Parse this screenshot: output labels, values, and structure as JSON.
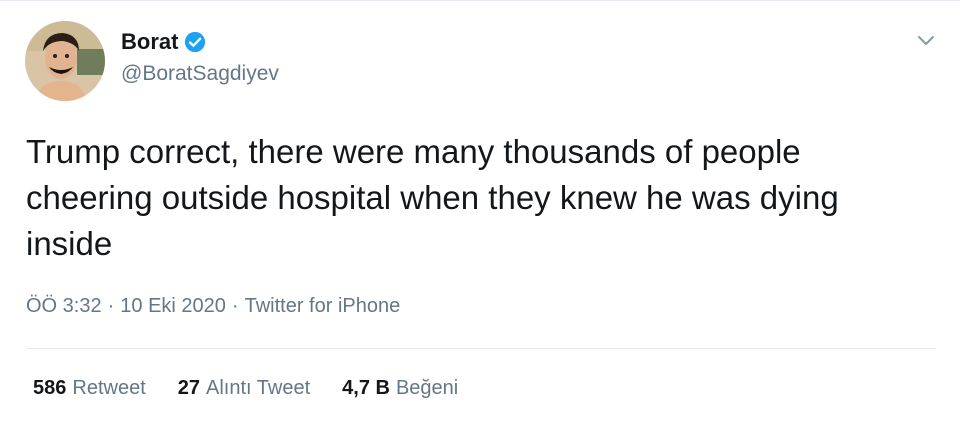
{
  "author": {
    "display_name": "Borat",
    "handle": "@BoratSagdiyev",
    "verified": true,
    "avatar_icon": "profile-photo-icon"
  },
  "tweet": {
    "text": "Trump correct, there were many thousands of people\ncheering outside hospital when they knew he was dying\ninside",
    "time": "ÖÖ 3:32",
    "separator": "·",
    "date": "10 Eki 2020",
    "source": "Twitter for iPhone"
  },
  "stats": [
    {
      "count": "586",
      "label": "Retweet"
    },
    {
      "count": "27",
      "label": "Alıntı Tweet"
    },
    {
      "count": "4,7 B",
      "label": "Beğeni"
    }
  ],
  "colors": {
    "primary_text": "#14171a",
    "secondary_text": "#657786",
    "verified_blue": "#1da1f2",
    "divider": "#e6ecf0"
  },
  "icons": {
    "verified": "verified-badge-icon",
    "menu": "chevron-down-icon"
  }
}
